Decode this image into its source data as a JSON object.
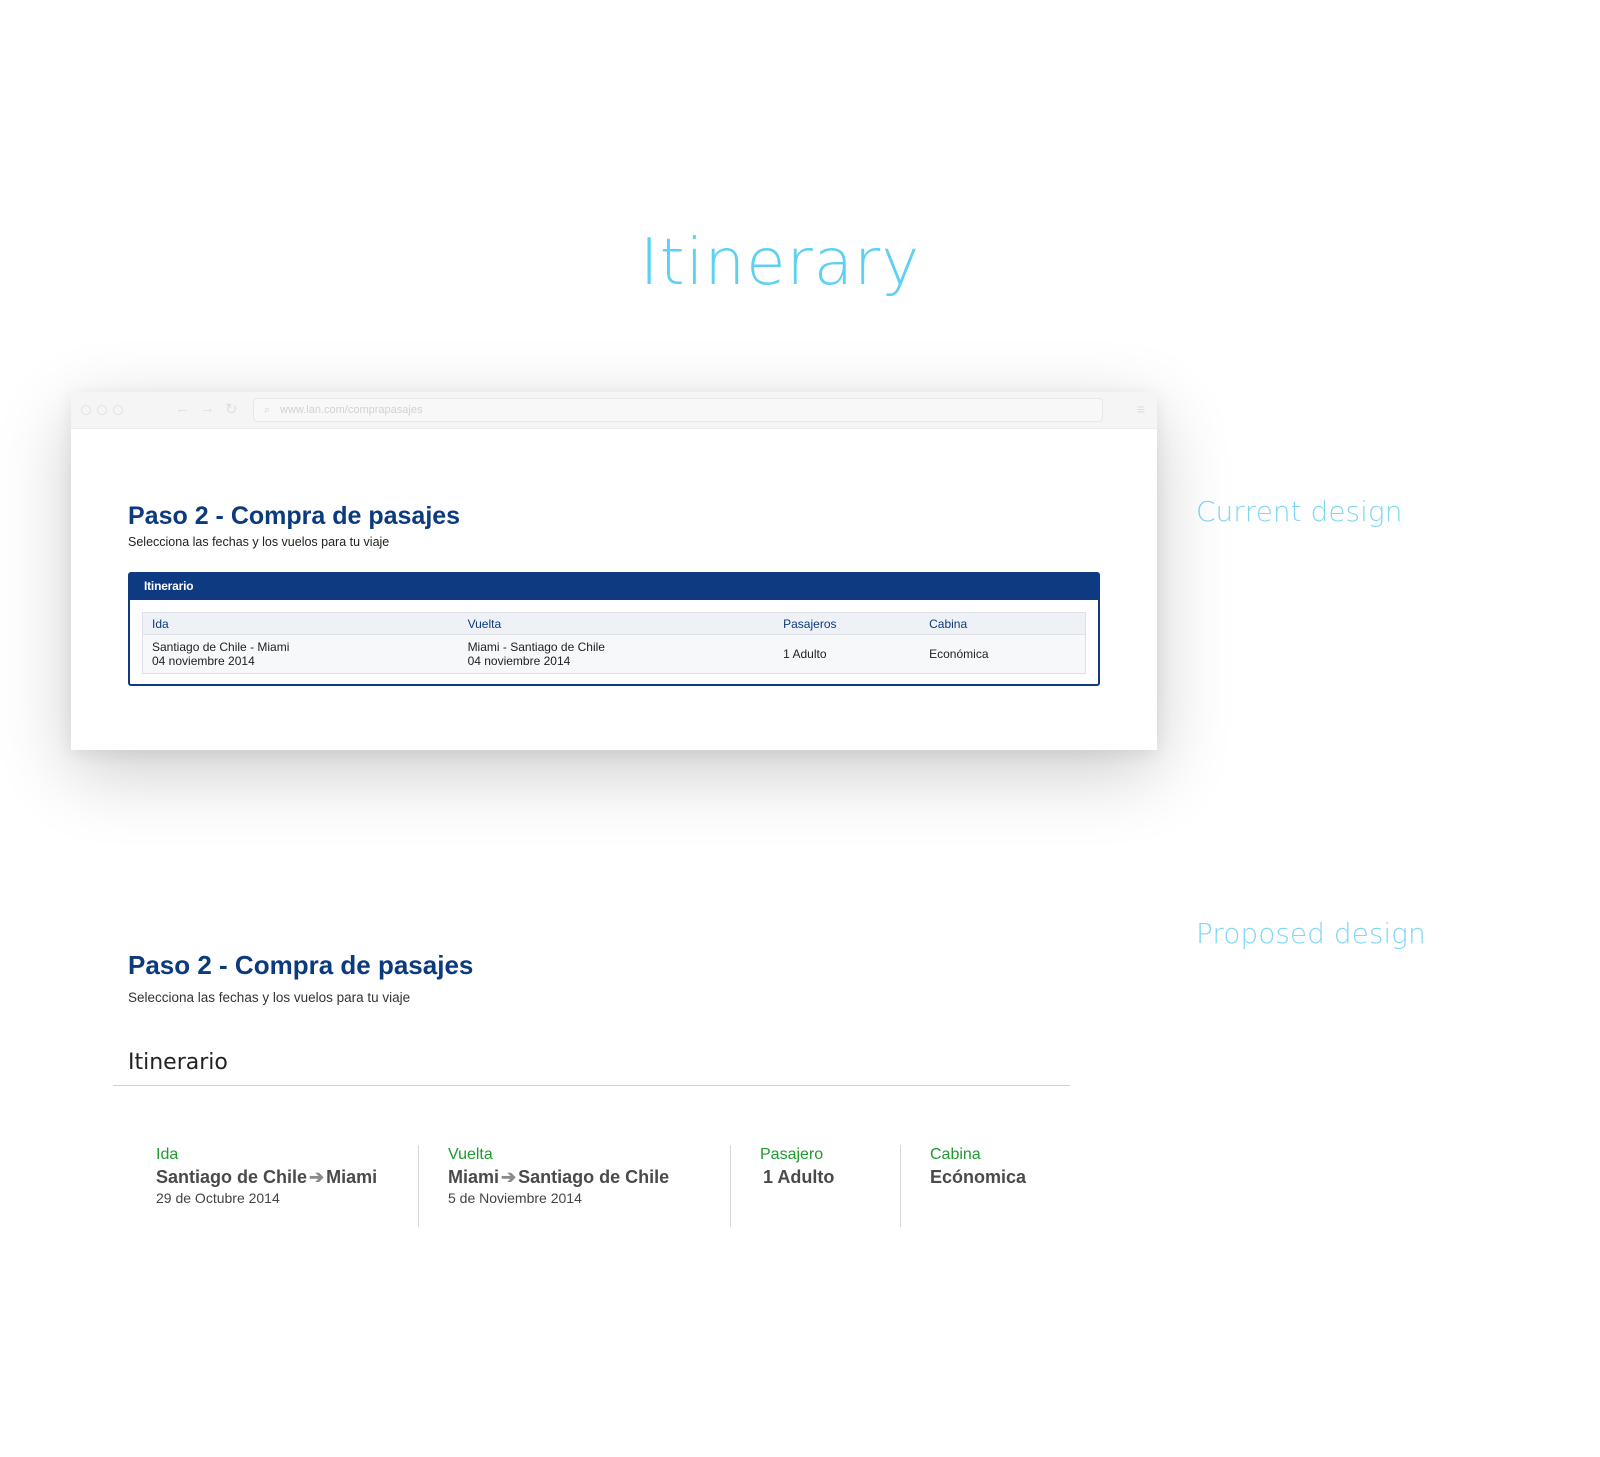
{
  "heading": "Itinerary",
  "labels": {
    "current": "Current design",
    "proposed": "Proposed design"
  },
  "browser": {
    "url": "www.lan.com/comprapasajes"
  },
  "current": {
    "title": "Paso 2 - Compra de pasajes",
    "subtitle": "Selecciona las fechas y los vuelos para tu viaje",
    "box_title": "Itinerario",
    "columns": [
      "Ida",
      "Vuelta",
      "Pasajeros",
      "Cabina"
    ],
    "row": {
      "ida_route": "Santiago de Chile - Miami",
      "ida_date": "04 noviembre 2014",
      "vuelta_route": "Miami - Santiago de Chile",
      "vuelta_date": "04 noviembre 2014",
      "pasajeros": "1 Adulto",
      "cabina": "Económica"
    }
  },
  "proposed": {
    "title": "Paso 2 - Compra de pasajes",
    "subtitle": "Selecciona las fechas y los vuelos para tu viaje",
    "section_title": "Itinerario",
    "ida": {
      "label": "Ida",
      "from": "Santiago de Chile",
      "to": "Miami",
      "date": "29 de Octubre 2014"
    },
    "vuelta": {
      "label": "Vuelta",
      "from": "Miami",
      "to": "Santiago de Chile",
      "date": "5 de Noviembre 2014"
    },
    "pasajero": {
      "label": "Pasajero",
      "value": "1 Adulto"
    },
    "cabina": {
      "label": "Cabina",
      "value": "Ecónomica"
    }
  },
  "colors": {
    "heading": "#5ed1f2",
    "brand_blue": "#0b3a7e",
    "label_green": "#1e9a2e"
  }
}
